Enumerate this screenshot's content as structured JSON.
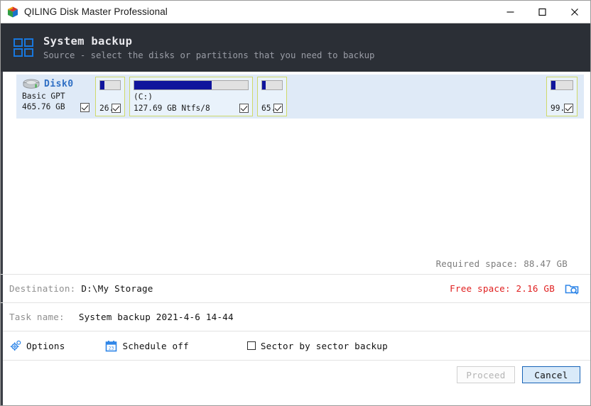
{
  "window": {
    "title": "QILING Disk Master Professional",
    "app_icon": "cube-icon",
    "minimize_label": "minimize-icon",
    "maximize_label": "maximize-icon",
    "close_label": "close-icon"
  },
  "header": {
    "icon": "grid-squares-icon",
    "title": "System backup",
    "subtitle": "Source - select the disks or partitions that you need to backup"
  },
  "disk": {
    "icon": "hard-disk-icon",
    "name": "Disk0",
    "type": "Basic GPT",
    "size": "465.76 GB",
    "checked": true,
    "partitions": [
      {
        "label": "",
        "size": "26.",
        "usedPercent": 22,
        "checked": true,
        "width": "sm"
      },
      {
        "label": "(C:)",
        "size": "127.69 GB Ntfs/8",
        "usedPercent": 68,
        "checked": true,
        "width": "lg"
      },
      {
        "label": "",
        "size": "65.",
        "usedPercent": 18,
        "checked": true,
        "width": "sm"
      },
      {
        "label": "",
        "size": "99.",
        "usedPercent": 20,
        "checked": true,
        "width": "right"
      }
    ]
  },
  "required_space": "Required space: 88.47 GB",
  "destination": {
    "label": "Destination:",
    "value": "D:\\My Storage",
    "free_space": "Free space: 2.16 GB",
    "browse_icon": "folder-search-icon"
  },
  "task": {
    "label": "Task name:",
    "value": "System backup 2021-4-6 14-44"
  },
  "options_bar": {
    "options_icon": "gear-icon",
    "options_label": "Options",
    "schedule_icon": "calendar-icon",
    "schedule_label": "Schedule off",
    "sector_label": "Sector by sector backup",
    "sector_checked": false
  },
  "footer": {
    "proceed_label": "Proceed",
    "proceed_enabled": false,
    "cancel_label": "Cancel"
  },
  "colors": {
    "header_bg": "#2b2f36",
    "accent_blue": "#2f6fc4",
    "bar_fill": "#10149c",
    "free_space_red": "#e02020",
    "partition_border": "#cfd96a"
  }
}
